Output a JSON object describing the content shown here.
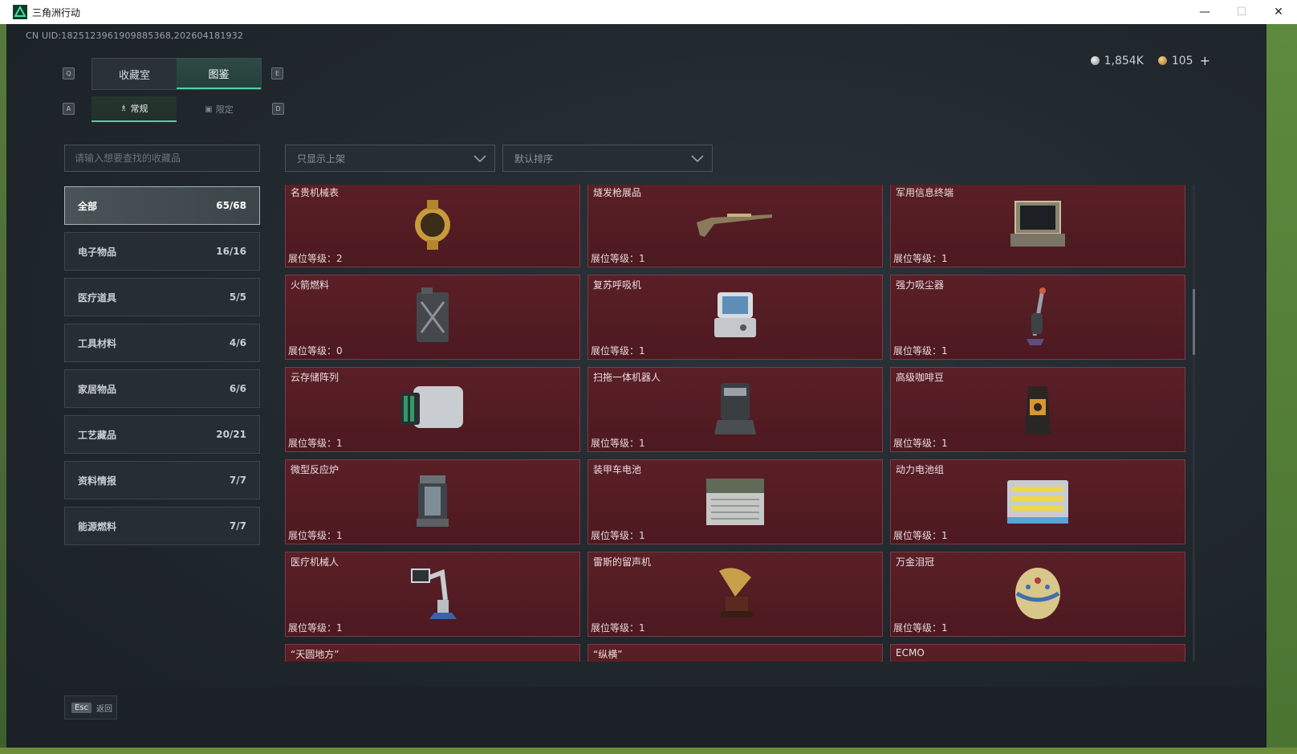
{
  "window": {
    "title": "三角洲行动",
    "minimize": "—",
    "maximize": "☐",
    "close": "✕"
  },
  "uid": "CN UID:1825123961909885368,202604181932",
  "currency": {
    "silver": "1,854K",
    "gold": "105",
    "plus": "+"
  },
  "keys": {
    "q": "Q",
    "e": "E",
    "a": "A",
    "d": "D"
  },
  "tabs": [
    {
      "label": "收藏室"
    },
    {
      "label": "图鉴"
    }
  ],
  "subtabs": [
    {
      "label": "常规"
    },
    {
      "label": "限定"
    }
  ],
  "search": {
    "placeholder": "请输入想要查找的收藏品",
    "value": ""
  },
  "categories": [
    {
      "label": "全部",
      "count": "65/68"
    },
    {
      "label": "电子物品",
      "count": "16/16"
    },
    {
      "label": "医疗道具",
      "count": "5/5"
    },
    {
      "label": "工具材料",
      "count": "4/6"
    },
    {
      "label": "家居物品",
      "count": "6/6"
    },
    {
      "label": "工艺藏品",
      "count": "20/21"
    },
    {
      "label": "资料情报",
      "count": "7/7"
    },
    {
      "label": "能源燃料",
      "count": "7/7"
    }
  ],
  "filters": {
    "display": "只显示上架",
    "sort": "默认排序"
  },
  "items": [
    {
      "name": "名贵机械表",
      "level": "展位等级：2",
      "icon": "watch-icon"
    },
    {
      "name": "燧发枪展品",
      "level": "展位等级：1",
      "icon": "rifle-icon"
    },
    {
      "name": "军用信息终端",
      "level": "展位等级：1",
      "icon": "terminal-icon"
    },
    {
      "name": "火箭燃料",
      "level": "展位等级：0",
      "icon": "fuel-can-icon"
    },
    {
      "name": "复苏呼吸机",
      "level": "展位等级：1",
      "icon": "ventilator-icon"
    },
    {
      "name": "强力吸尘器",
      "level": "展位等级：1",
      "icon": "vacuum-icon"
    },
    {
      "name": "云存储阵列",
      "level": "展位等级：1",
      "icon": "storage-array-icon"
    },
    {
      "name": "扫拖一体机器人",
      "level": "展位等级：1",
      "icon": "robot-mop-icon"
    },
    {
      "name": "高级咖啡豆",
      "level": "展位等级：1",
      "icon": "coffee-bag-icon"
    },
    {
      "name": "微型反应炉",
      "level": "展位等级：1",
      "icon": "reactor-icon"
    },
    {
      "name": "装甲车电池",
      "level": "展位等级：1",
      "icon": "battery-icon"
    },
    {
      "name": "动力电池组",
      "level": "展位等级：1",
      "icon": "battery-pack-icon"
    },
    {
      "name": "医疗机械人",
      "level": "展位等级：1",
      "icon": "medical-robot-icon"
    },
    {
      "name": "雷斯的留声机",
      "level": "展位等级：1",
      "icon": "gramophone-icon"
    },
    {
      "name": "万金泪冠",
      "level": "展位等级：1",
      "icon": "jeweled-egg-icon"
    },
    {
      "name": "“天圆地方”",
      "level": "",
      "icon": "gold-ornament-icon"
    },
    {
      "name": "“纵横”",
      "level": "",
      "icon": "gold-ornament-icon"
    },
    {
      "name": "ECMO",
      "level": "",
      "icon": "ecmo-icon"
    }
  ],
  "footer": {
    "esc_key": "Esc",
    "esc_label": "返回"
  },
  "colors": {
    "accent": "#4fd1a3",
    "card_bg": "#561d25",
    "card_border": "#7d3a43"
  }
}
